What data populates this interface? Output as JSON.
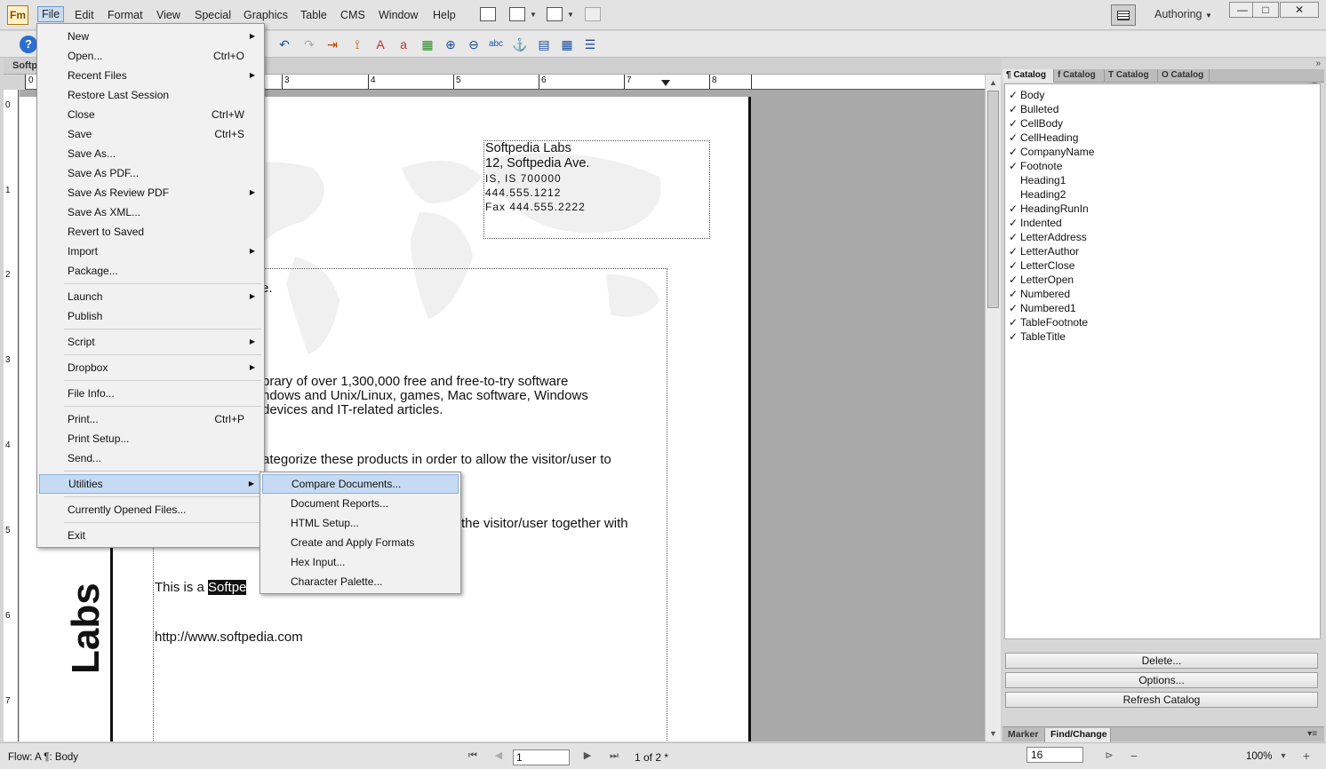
{
  "app": {
    "logo": "Fm"
  },
  "menubar": {
    "items": [
      "File",
      "Edit",
      "Format",
      "View",
      "Special",
      "Graphics",
      "Table",
      "CMS",
      "Window",
      "Help"
    ],
    "workspace": "Authoring"
  },
  "window_controls": {
    "minimize": "—",
    "maximize": "□",
    "close": "✕"
  },
  "toolbar": {
    "help": "?",
    "icons": [
      "new-icon",
      "open-icon",
      "save-icon",
      "print-icon",
      "undo-icon",
      "redo-icon",
      "insert-icon",
      "styles-icon",
      "para-icon",
      "char-icon",
      "table-icon",
      "zoom-in-icon",
      "zoom-out-icon",
      "spell-icon",
      "anchor-icon",
      "text-frame-icon",
      "grid-icon",
      "align-icon"
    ]
  },
  "document": {
    "tab_label": "Softp",
    "ruler_marks": [
      "0",
      "3",
      "4",
      "5",
      "6",
      "7",
      "8"
    ],
    "vruler_marks": [
      "0",
      "1",
      "2",
      "3",
      "4",
      "5",
      "6",
      "7"
    ],
    "side_label": "Labs",
    "address": {
      "company": "Softpedia Labs",
      "street": "12, Softpedia Ave.",
      "city": "IS, IS 700000",
      "phone": "444.555.1212",
      "fax": "Fax 444.555.2222"
    },
    "body_lines": [
      "e.",
      "brary of over 1,300,000 free and free-to-try software",
      "ndows and Unix/Linux, games, Mac software, Windows",
      "devices and IT-related articles.",
      "ategorize these products in order to allow the visitor/user to",
      "the visitor/user together with"
    ],
    "this_is_a": "This is a",
    "highlight_fragment": "Softpe",
    "url": "http://www.softpedia.com"
  },
  "file_menu": {
    "items": [
      {
        "label": "New",
        "shortcut": "",
        "submenu": true
      },
      {
        "label": "Open...",
        "shortcut": "Ctrl+O",
        "submenu": false
      },
      {
        "label": "Recent Files",
        "shortcut": "",
        "submenu": true
      },
      {
        "label": "Restore Last Session",
        "shortcut": "",
        "submenu": false
      },
      {
        "label": "Close",
        "shortcut": "Ctrl+W",
        "submenu": false
      },
      {
        "label": "Save",
        "shortcut": "Ctrl+S",
        "submenu": false
      },
      {
        "label": "Save As...",
        "shortcut": "",
        "submenu": false
      },
      {
        "label": "Save As PDF...",
        "shortcut": "",
        "submenu": false
      },
      {
        "label": "Save As Review PDF",
        "shortcut": "",
        "submenu": true
      },
      {
        "label": "Save As XML...",
        "shortcut": "",
        "submenu": false
      },
      {
        "label": "Revert to Saved",
        "shortcut": "",
        "submenu": false
      },
      {
        "label": "Import",
        "shortcut": "",
        "submenu": true
      },
      {
        "label": "Package...",
        "shortcut": "",
        "submenu": false
      },
      {
        "label": "Launch",
        "shortcut": "",
        "submenu": true
      },
      {
        "label": "Publish",
        "shortcut": "",
        "submenu": false
      },
      {
        "label": "Script",
        "shortcut": "",
        "submenu": true
      },
      {
        "label": "Dropbox",
        "shortcut": "",
        "submenu": true
      },
      {
        "label": "File Info...",
        "shortcut": "",
        "submenu": false
      },
      {
        "label": "Print...",
        "shortcut": "Ctrl+P",
        "submenu": false
      },
      {
        "label": "Print Setup...",
        "shortcut": "",
        "submenu": false
      },
      {
        "label": "Send...",
        "shortcut": "",
        "submenu": false
      },
      {
        "label": "Utilities",
        "shortcut": "",
        "submenu": true
      },
      {
        "label": "Currently Opened Files...",
        "shortcut": "",
        "submenu": false
      },
      {
        "label": "Exit",
        "shortcut": "",
        "submenu": false
      }
    ]
  },
  "utilities_menu": {
    "items": [
      "Compare Documents...",
      "Document Reports...",
      "HTML Setup...",
      "Create and Apply Formats",
      "Hex Input...",
      "Character Palette..."
    ]
  },
  "panel": {
    "tabs": [
      "¶ Catalog",
      "f Catalog",
      "T Catalog",
      "O Catalog"
    ],
    "active_tab": "¶ Catalog",
    "catalog_items": [
      {
        "name": "Body",
        "checked": true
      },
      {
        "name": "Bulleted",
        "checked": true
      },
      {
        "name": "CellBody",
        "checked": true
      },
      {
        "name": "CellHeading",
        "checked": true
      },
      {
        "name": "CompanyName",
        "checked": true
      },
      {
        "name": "Footnote",
        "checked": true
      },
      {
        "name": "Heading1",
        "checked": false
      },
      {
        "name": "Heading2",
        "checked": false
      },
      {
        "name": "HeadingRunIn",
        "checked": true
      },
      {
        "name": "Indented",
        "checked": true
      },
      {
        "name": "LetterAddress",
        "checked": true
      },
      {
        "name": "LetterAuthor",
        "checked": true
      },
      {
        "name": "LetterClose",
        "checked": true
      },
      {
        "name": "LetterOpen",
        "checked": true
      },
      {
        "name": "Numbered",
        "checked": true
      },
      {
        "name": "Numbered1",
        "checked": true
      },
      {
        "name": "TableFootnote",
        "checked": true
      },
      {
        "name": "TableTitle",
        "checked": true
      }
    ],
    "buttons": {
      "delete": "Delete...",
      "options": "Options...",
      "refresh": "Refresh Catalog"
    },
    "bottom_tabs": [
      "Marker",
      "Find/Change"
    ],
    "active_bottom_tab": "Find/Change"
  },
  "status": {
    "flow": "Flow: A   ¶: Body",
    "page_number": "1",
    "page_count": "1 of 2 *",
    "zoom_field": "16",
    "zoom_level": "100%"
  },
  "colors": {
    "menu_highlight": "#c6dbf3",
    "selection": "#111111"
  }
}
